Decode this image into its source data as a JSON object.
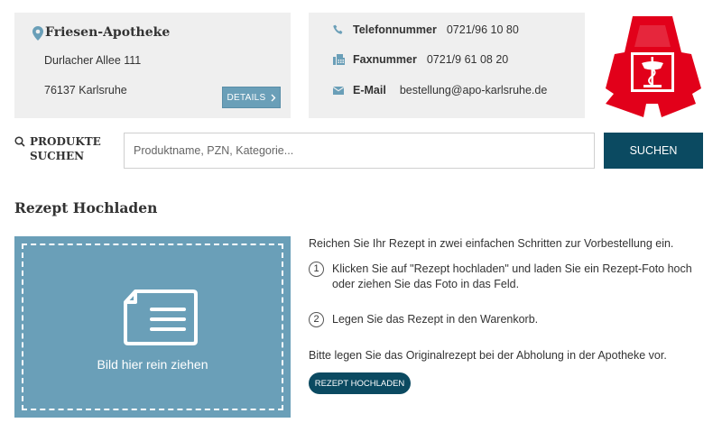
{
  "pharmacy": {
    "name": "Friesen-Apotheke",
    "street": "Durlacher Allee 111",
    "city": "76137 Karlsruhe",
    "details_label": "DETAILS"
  },
  "contact": {
    "phone_label": "Telefonnummer",
    "phone_value": "0721/96 10 80",
    "fax_label": "Faxnummer",
    "fax_value": "0721/9 61 08 20",
    "email_label": "E-Mail",
    "email_value": "bestellung@apo-karlsruhe.de"
  },
  "logo": {
    "icon": "apotheke-a-logo",
    "color": "#e2001a"
  },
  "search": {
    "label_line1": "PRODUKTE",
    "label_line2": "SUCHEN",
    "placeholder": "Produktname, PZN, Kategorie...",
    "button_label": "SUCHEN"
  },
  "prescription": {
    "title": "Rezept Hochladen",
    "dropzone_text": "Bild hier rein ziehen",
    "intro": "Reichen Sie Ihr Rezept in zwei einfachen Schritten zur Vorbestellung ein.",
    "steps": [
      {
        "number": "1",
        "text": "Klicken Sie auf \"Rezept hochladen\" und laden Sie ein Rezept-Foto hoch oder ziehen Sie das Foto in das Feld."
      },
      {
        "number": "2",
        "text": "Legen Sie das Rezept in den Warenkorb."
      }
    ],
    "note": "Bitte legen Sie das Originalrezept bei der Abholung in der Apotheke vor.",
    "upload_label": "REZEPT HOCHLADEN"
  },
  "colors": {
    "accent_dark": "#0b4a61",
    "accent_light": "#6a9fb8",
    "box_background": "#efefef",
    "logo_red": "#e2001a"
  }
}
